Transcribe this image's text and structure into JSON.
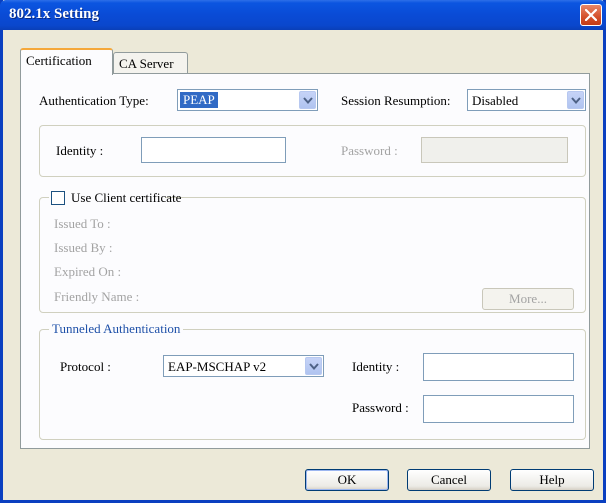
{
  "window": {
    "title": "802.1x Setting"
  },
  "tabs": [
    {
      "label": "Certification",
      "active": true
    },
    {
      "label": "CA Server",
      "active": false
    }
  ],
  "auth": {
    "type_label": "Authentication Type:",
    "type_value": "PEAP",
    "session_label": "Session Resumption:",
    "session_value": "Disabled"
  },
  "identity_row": {
    "identity_label": "Identity :",
    "identity_value": "",
    "password_label": "Password :",
    "password_value": ""
  },
  "client_cert": {
    "checkbox_label": "Use Client certificate",
    "checked": false,
    "issued_to_label": "Issued To :",
    "issued_by_label": "Issued By :",
    "expired_on_label": "Expired On :",
    "friendly_name_label": "Friendly Name :",
    "more_button": "More..."
  },
  "tunneled": {
    "group_label": "Tunneled Authentication",
    "protocol_label": "Protocol :",
    "protocol_value": "EAP-MSCHAP v2",
    "identity_label": "Identity :",
    "identity_value": "",
    "password_label": "Password :",
    "password_value": ""
  },
  "buttons": {
    "ok": "OK",
    "cancel": "Cancel",
    "help": "Help"
  },
  "colors": {
    "titlebar": "#0a4bd6",
    "accent_tab": "#f5a83b",
    "group_label": "#1e50a8",
    "disabled_text": "#a3a3a3"
  }
}
